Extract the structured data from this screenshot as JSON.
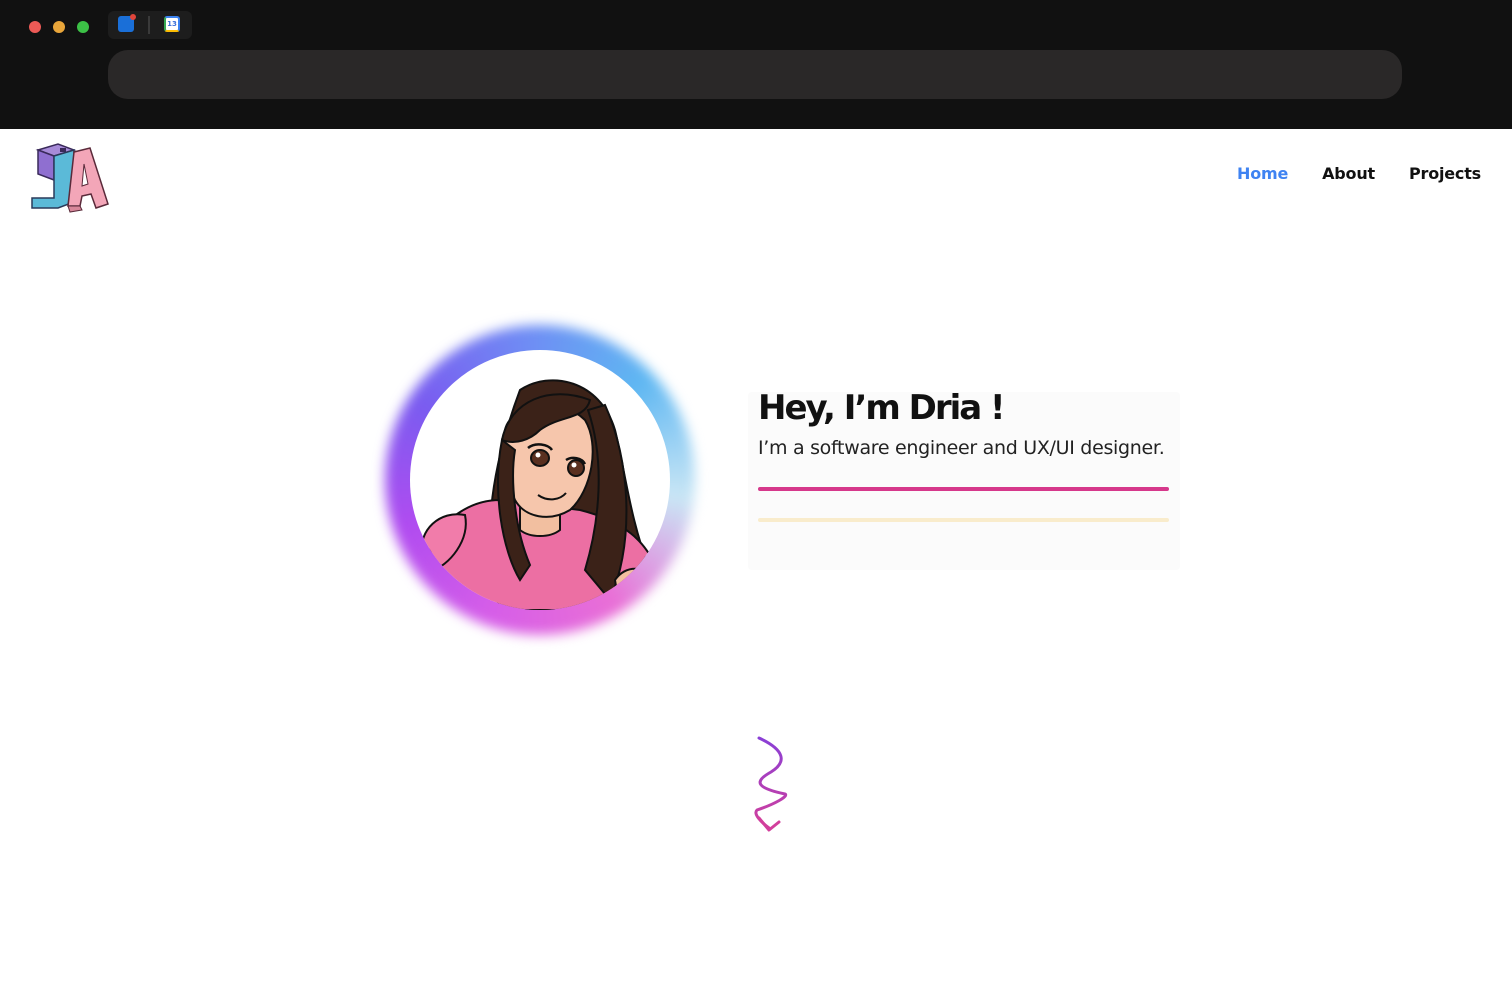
{
  "browser": {
    "tabs": [
      {
        "icon": "outlook-icon"
      },
      {
        "icon": "google-calendar-icon",
        "badge": "13"
      }
    ],
    "address_bar": {
      "value": ""
    },
    "traffic_lights": [
      "close",
      "minimize",
      "maximize"
    ]
  },
  "site": {
    "logo": {
      "icon": "ja-logo-icon",
      "letters": "JA"
    },
    "nav": {
      "home": "Home",
      "about": "About",
      "projects": "Projects",
      "active": "home"
    },
    "hero": {
      "title": "Hey, I’m Dria !",
      "subtitle": "I’m a software engineer and UX/UI designer."
    },
    "scroll_indicator": {
      "icon": "squiggle-arrow-down-icon"
    }
  },
  "colors": {
    "chrome_bg": "#111111",
    "address_bar_bg": "#2a2828",
    "nav_active": "#3f83f2",
    "nav_text": "#111111",
    "underline_pink": "#d6388b",
    "underline_cream": "#f9eccc",
    "arrow": "#9c3fd8"
  }
}
